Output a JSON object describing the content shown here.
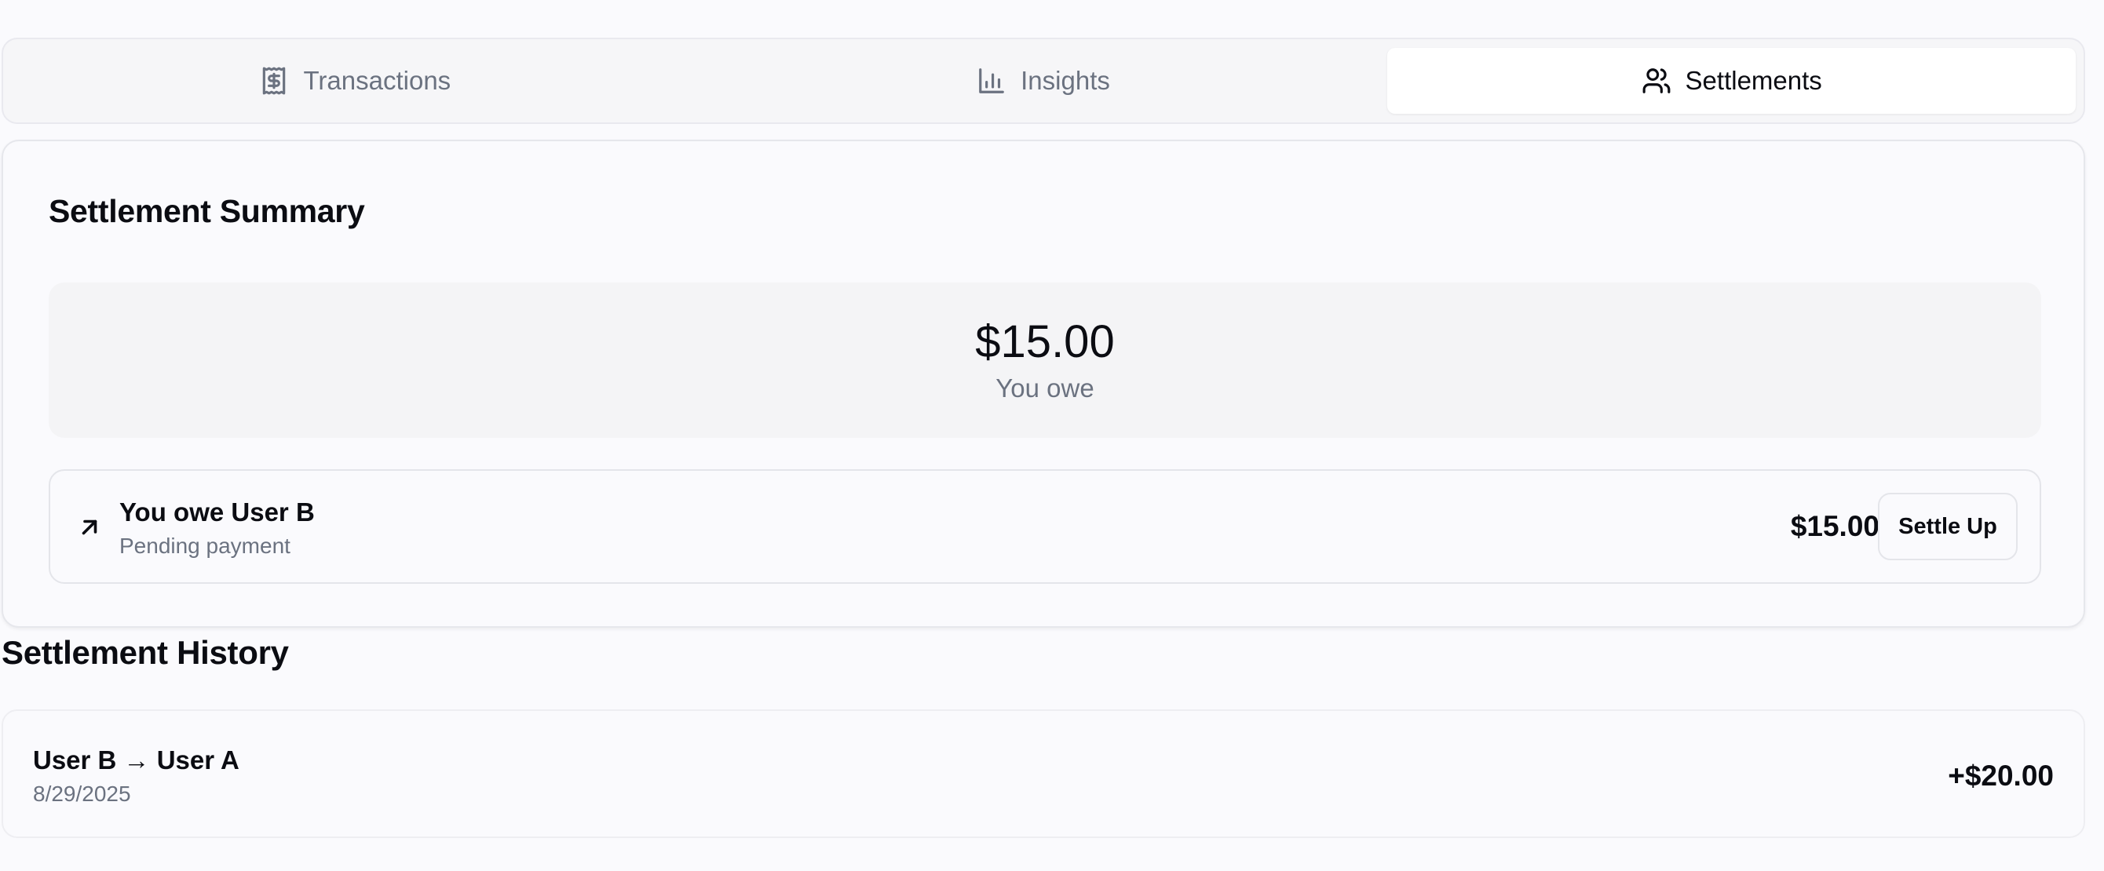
{
  "tabs": [
    {
      "label": "Transactions",
      "icon": "receipt-dollar-icon",
      "active": false
    },
    {
      "label": "Insights",
      "icon": "bar-chart-icon",
      "active": false
    },
    {
      "label": "Settlements",
      "icon": "users-icon",
      "active": true
    }
  ],
  "summary": {
    "title": "Settlement Summary",
    "balance_amount": "$15.00",
    "balance_label": "You owe",
    "debts": [
      {
        "icon": "arrow-up-right-icon",
        "title": "You owe User B",
        "status": "Pending payment",
        "amount": "$15.00",
        "action_label": "Settle Up"
      }
    ]
  },
  "history": {
    "title": "Settlement History",
    "items": [
      {
        "names": "User B → User A",
        "date": "8/29/2025",
        "amount": "+$20.00"
      }
    ]
  },
  "colors": {
    "background": "#fafafd",
    "tab_bar": "#f6f6f8",
    "muted_text": "#6b7280",
    "text": "#0b0c12",
    "balance_box": "#f4f4f6"
  }
}
